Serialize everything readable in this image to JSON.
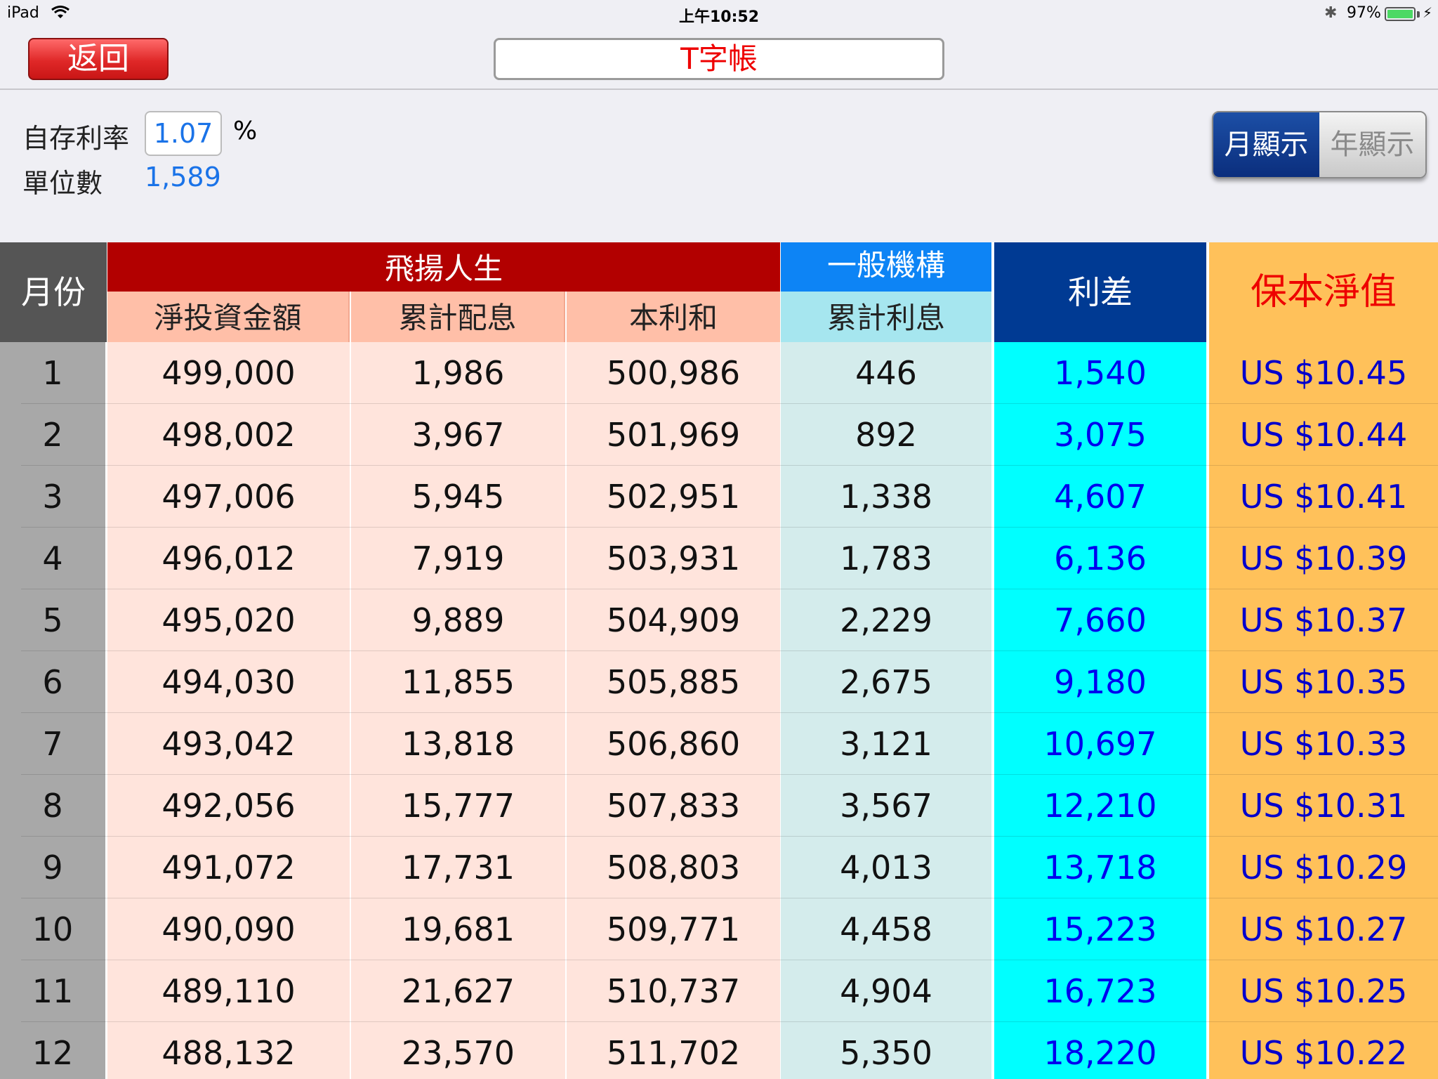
{
  "status_bar": {
    "device": "iPad",
    "time": "上午10:52",
    "battery": "97%"
  },
  "nav": {
    "back_label": "返回",
    "title": "T字帳"
  },
  "settings": {
    "rate_label": "自存利率",
    "rate_value": "1.07",
    "percent": "%",
    "units_label": "單位數",
    "units_value": "1,589",
    "toggle_month": "月顯示",
    "toggle_year": "年顯示"
  },
  "table": {
    "headers": {
      "month": "月份",
      "group_feiyang": "飛揚人生",
      "net_investment": "淨投資金額",
      "accum_dividend": "累計配息",
      "principal_interest": "本利和",
      "group_general": "一般機構",
      "accum_interest": "累計利息",
      "spread": "利差",
      "breakeven_nav": "保本淨值"
    },
    "rows": [
      [
        "1",
        "499,000",
        "1,986",
        "500,986",
        "446",
        "1,540",
        "US $10.45"
      ],
      [
        "2",
        "498,002",
        "3,967",
        "501,969",
        "892",
        "3,075",
        "US $10.44"
      ],
      [
        "3",
        "497,006",
        "5,945",
        "502,951",
        "1,338",
        "4,607",
        "US $10.41"
      ],
      [
        "4",
        "496,012",
        "7,919",
        "503,931",
        "1,783",
        "6,136",
        "US $10.39"
      ],
      [
        "5",
        "495,020",
        "9,889",
        "504,909",
        "2,229",
        "7,660",
        "US $10.37"
      ],
      [
        "6",
        "494,030",
        "11,855",
        "505,885",
        "2,675",
        "9,180",
        "US $10.35"
      ],
      [
        "7",
        "493,042",
        "13,818",
        "506,860",
        "3,121",
        "10,697",
        "US $10.33"
      ],
      [
        "8",
        "492,056",
        "15,777",
        "507,833",
        "3,567",
        "12,210",
        "US $10.31"
      ],
      [
        "9",
        "491,072",
        "17,731",
        "508,803",
        "4,013",
        "13,718",
        "US $10.29"
      ],
      [
        "10",
        "490,090",
        "19,681",
        "509,771",
        "4,458",
        "15,223",
        "US $10.27"
      ],
      [
        "11",
        "489,110",
        "21,627",
        "510,737",
        "4,904",
        "16,723",
        "US $10.25"
      ],
      [
        "12",
        "488,132",
        "23,570",
        "511,702",
        "5,350",
        "18,220",
        "US $10.22"
      ]
    ]
  },
  "colors": {
    "month_col_header": "#555555",
    "month_col_body": "#a8a8a8",
    "feiyang_group": "#b20000",
    "feiyang_sub": "#ffbfa8",
    "feiyang_body": "#ffe4dc",
    "general_group": "#0d84f5",
    "general_sub": "#a6e6ef",
    "general_body": "#d4ecec",
    "spread_header": "#003a93",
    "spread_body": "#00ffff",
    "spread_text": "#0000ee",
    "nav_header_bg": "#ffc15a",
    "nav_header_text": "#ee0000",
    "nav_body": "#ffc15a",
    "nav_text": "#0000cc"
  }
}
